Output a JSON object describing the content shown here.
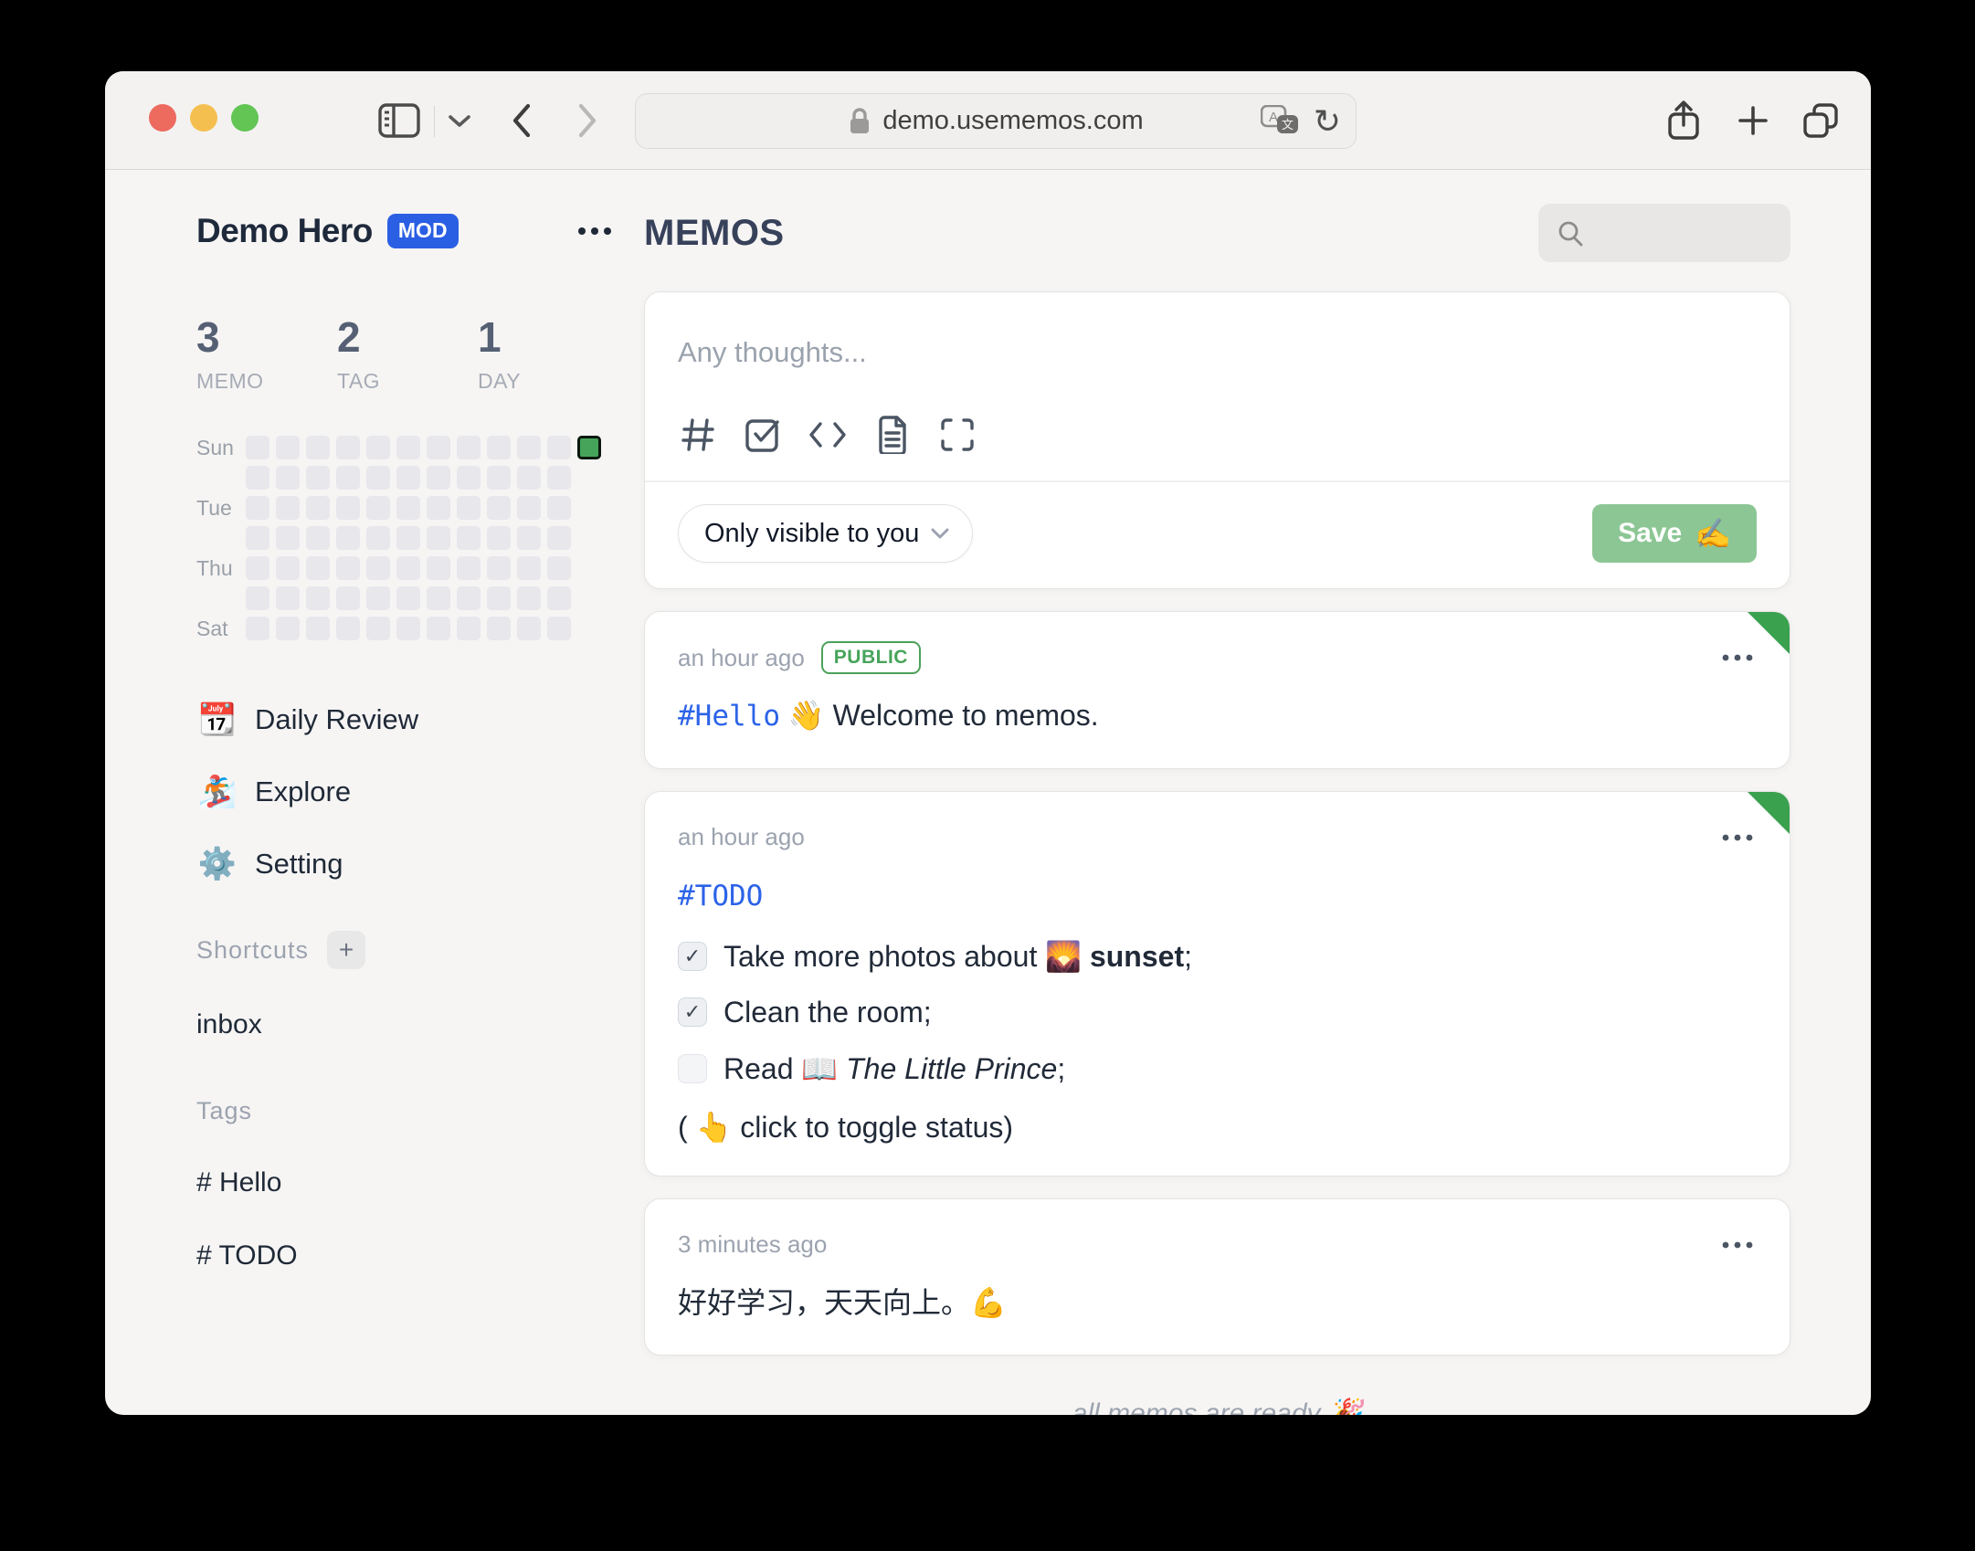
{
  "browser": {
    "url": "demo.usememos.com",
    "traffic_colors": [
      "#ed6a5f",
      "#f5bf4f",
      "#62c554"
    ],
    "reload_glyph": "↻"
  },
  "sidebar": {
    "user": {
      "name": "Demo Hero",
      "badge": "MOD"
    },
    "stats": [
      {
        "value": "3",
        "label": "MEMO"
      },
      {
        "value": "2",
        "label": "TAG"
      },
      {
        "value": "1",
        "label": "DAY"
      }
    ],
    "heatmap": {
      "day_labels": [
        "Sun",
        "",
        "Tue",
        "",
        "Thu",
        "",
        "Sat"
      ],
      "rows": 7,
      "weeks": 12,
      "active": {
        "row": 0,
        "col": 11
      },
      "cell_color": "#e7e7ec",
      "active_color": "#46a45a"
    },
    "nav": [
      {
        "icon": "📆",
        "label": "Daily Review"
      },
      {
        "icon": "🏂",
        "label": "Explore"
      },
      {
        "icon": "⚙️",
        "label": "Setting"
      }
    ],
    "shortcuts_label": "Shortcuts",
    "add_button": "+",
    "shortcut_items": [
      {
        "label": "inbox"
      }
    ],
    "tags_label": "Tags",
    "tags": [
      {
        "label": "# Hello"
      },
      {
        "label": "# TODO"
      }
    ]
  },
  "main": {
    "title": "MEMOS",
    "editor": {
      "placeholder": "Any thoughts...",
      "visibility": "Only visible to you",
      "save_label": "Save",
      "save_emoji": "✍️"
    },
    "check_glyph": "✓",
    "memos": [
      {
        "time": "an hour ago",
        "badge": "PUBLIC",
        "pinned": true,
        "content": {
          "tag": "#Hello",
          "emoji": "👋",
          "text": "Welcome to memos."
        }
      },
      {
        "time": "an hour ago",
        "pinned": true,
        "tag": "#TODO",
        "tasks": [
          {
            "checked": true,
            "before": "Take more photos about ",
            "emoji": "🌄",
            "bold": "sunset",
            "after": ";"
          },
          {
            "checked": true,
            "before": "Clean the room;",
            "emoji": "",
            "bold": "",
            "after": ""
          },
          {
            "checked": false,
            "before": "Read ",
            "emoji": "📖",
            "italic": "The Little Prince",
            "after": ";"
          }
        ],
        "note": "( 👆 click to toggle status)"
      },
      {
        "time": "3 minutes ago",
        "text": "好好学习，天天向上。💪"
      }
    ],
    "footer": "all memos are ready 🎉"
  }
}
